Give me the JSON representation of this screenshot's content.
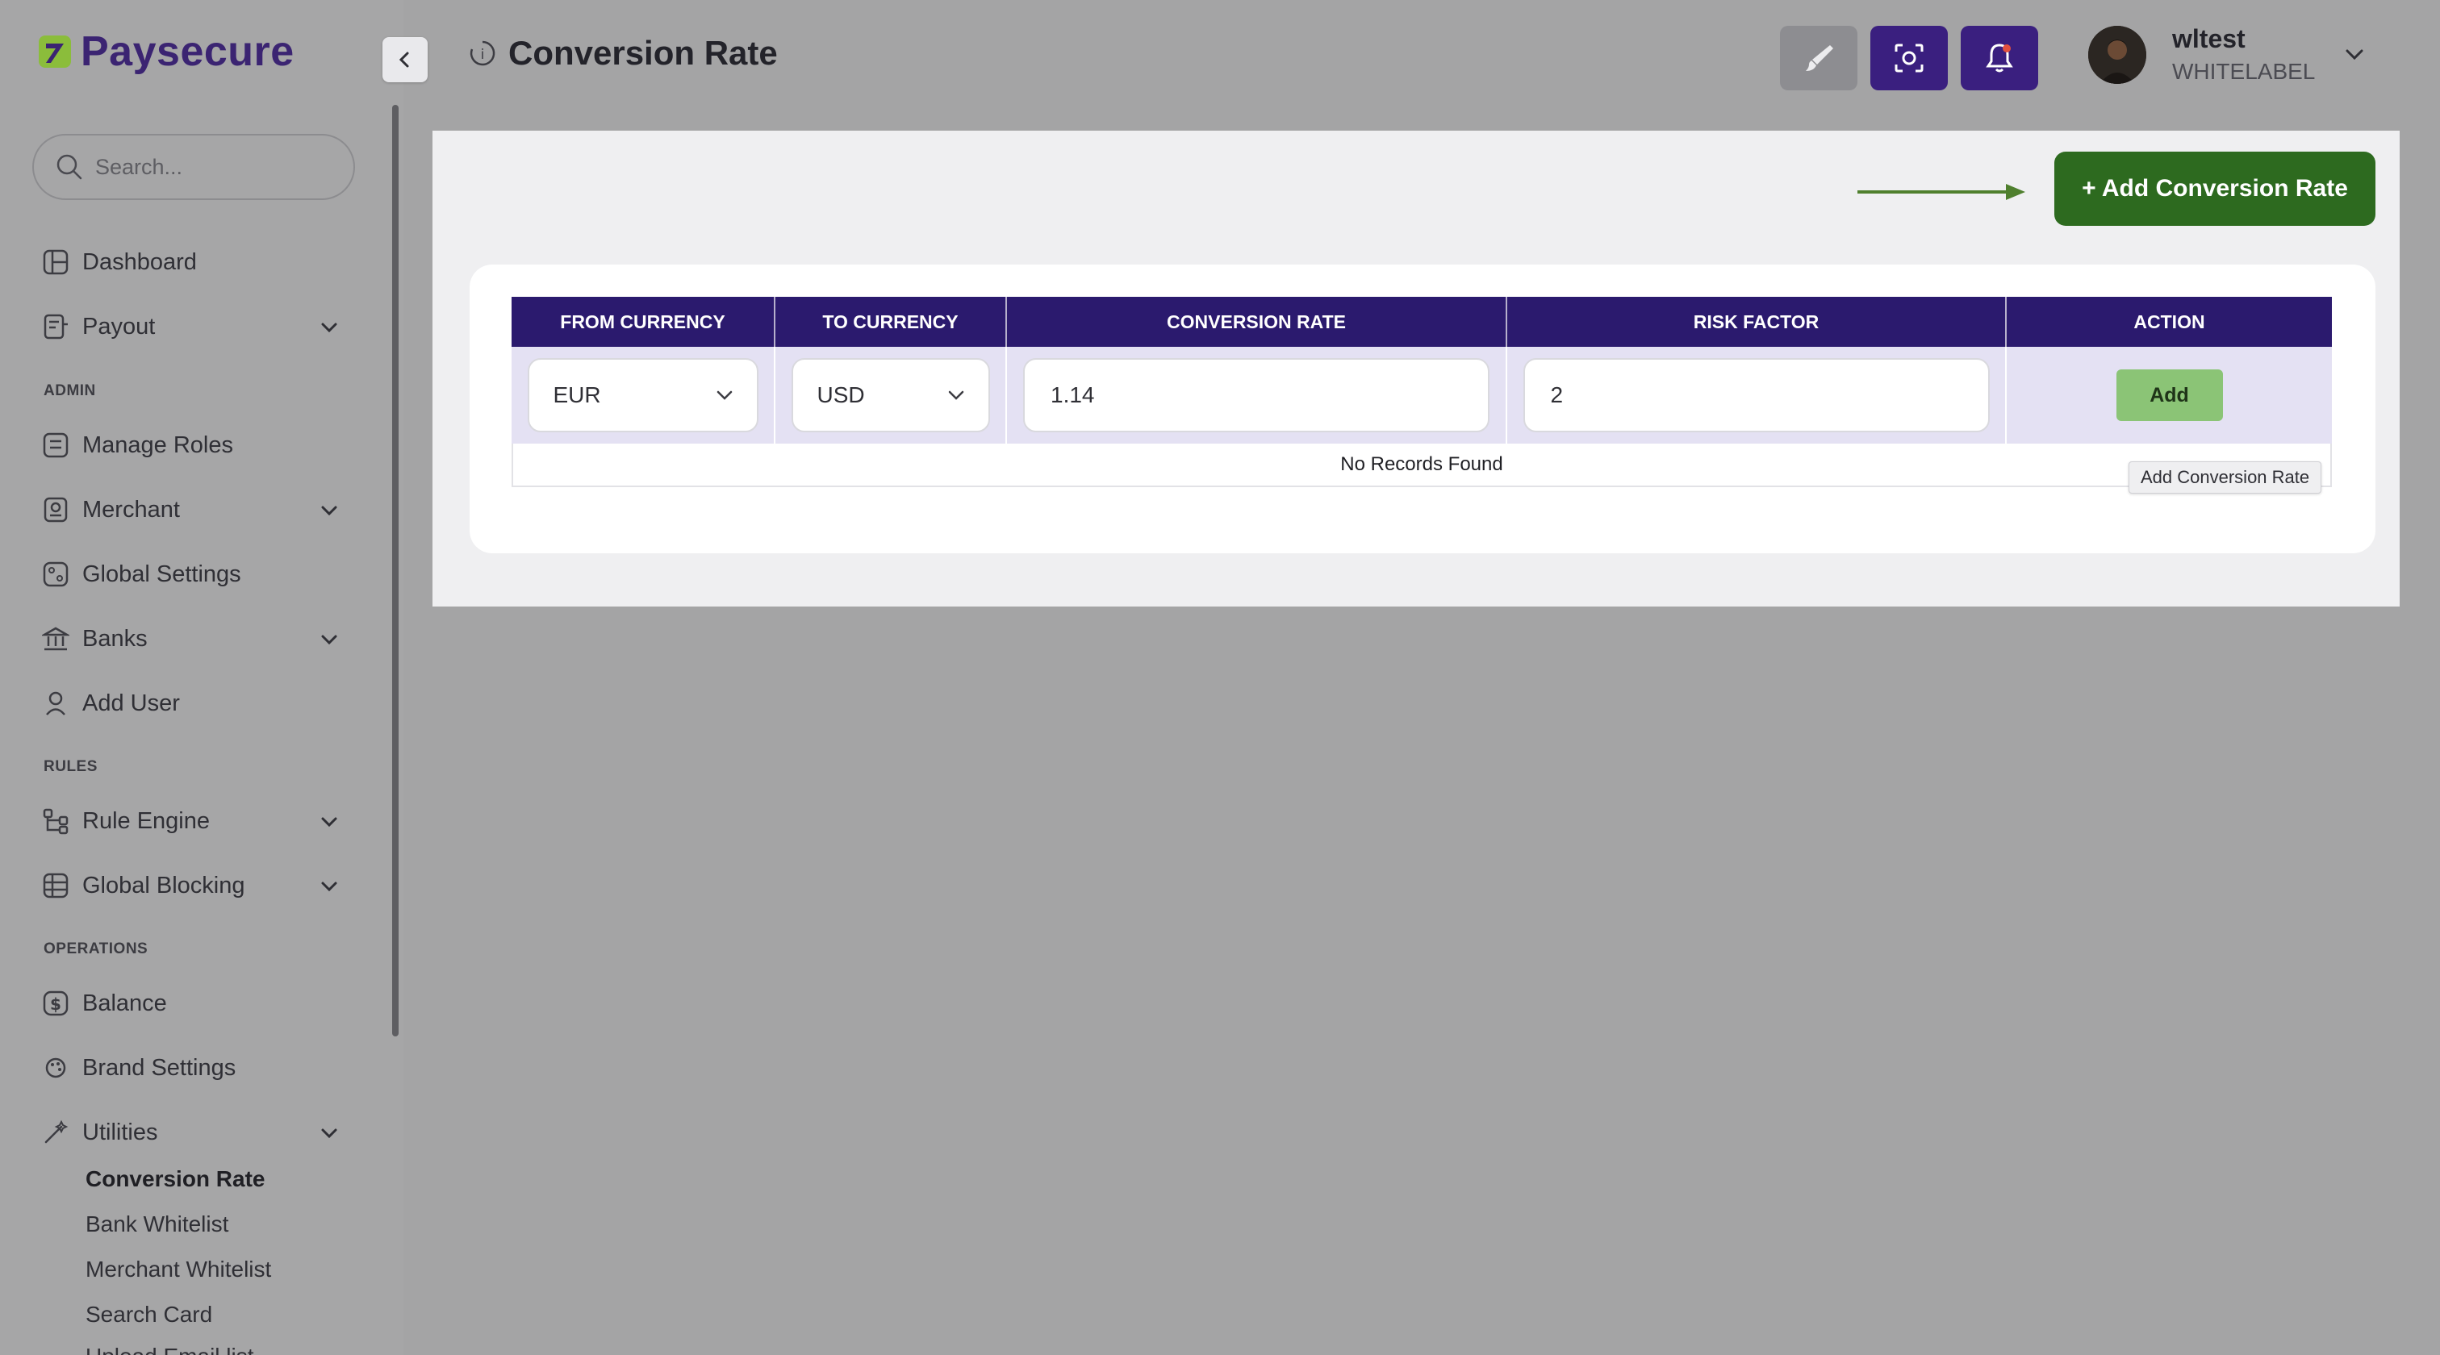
{
  "brand": {
    "name": "Paysecure",
    "accent": "#3b2472",
    "logo_mark_color": "#8bbd3b"
  },
  "search": {
    "placeholder": "Search..."
  },
  "sidebar": {
    "items": [
      {
        "label": "Dashboard",
        "icon": "dashboard-icon"
      },
      {
        "label": "Payout",
        "icon": "payout-icon",
        "expandable": true
      },
      {
        "label": "Manage Roles",
        "icon": "roles-icon"
      },
      {
        "label": "Merchant",
        "icon": "merchant-icon",
        "expandable": true
      },
      {
        "label": "Global Settings",
        "icon": "global-settings-icon"
      },
      {
        "label": "Banks",
        "icon": "bank-icon",
        "expandable": true
      },
      {
        "label": "Add User",
        "icon": "user-icon"
      },
      {
        "label": "Rule Engine",
        "icon": "rule-engine-icon",
        "expandable": true
      },
      {
        "label": "Global Blocking",
        "icon": "global-blocking-icon",
        "expandable": true
      },
      {
        "label": "Balance",
        "icon": "balance-icon"
      },
      {
        "label": "Brand Settings",
        "icon": "brand-icon"
      },
      {
        "label": "Utilities",
        "icon": "utilities-icon",
        "expandable": true,
        "expanded": true
      }
    ],
    "sections": {
      "admin": "ADMIN",
      "rules": "RULES",
      "operations": "OPERATIONS"
    },
    "utilities_children": [
      {
        "label": "Conversion Rate",
        "active": true
      },
      {
        "label": "Bank Whitelist"
      },
      {
        "label": "Merchant Whitelist"
      },
      {
        "label": "Search Card"
      },
      {
        "label": "Upload Email list"
      }
    ]
  },
  "header": {
    "title": "Conversion Rate",
    "user": {
      "name": "wltest",
      "role": "WHITELABEL"
    },
    "buttons": [
      {
        "icon": "brush-icon",
        "color": "#8d8d91"
      },
      {
        "icon": "screenshot-icon",
        "color": "#3a1f7f"
      },
      {
        "icon": "bell-icon",
        "color": "#3a1f7f",
        "notification": true
      }
    ]
  },
  "main": {
    "add_button_label": "+ Add Conversion Rate",
    "table": {
      "columns": [
        "FROM CURRENCY",
        "TO CURRENCY",
        "CONVERSION RATE",
        "RISK FACTOR",
        "ACTION"
      ],
      "new_row": {
        "from_currency": "EUR",
        "to_currency": "USD",
        "conversion_rate": "1.14",
        "risk_factor": "2",
        "action_label": "Add"
      },
      "empty_message": "No Records Found"
    },
    "tooltip": "Add Conversion Rate"
  }
}
